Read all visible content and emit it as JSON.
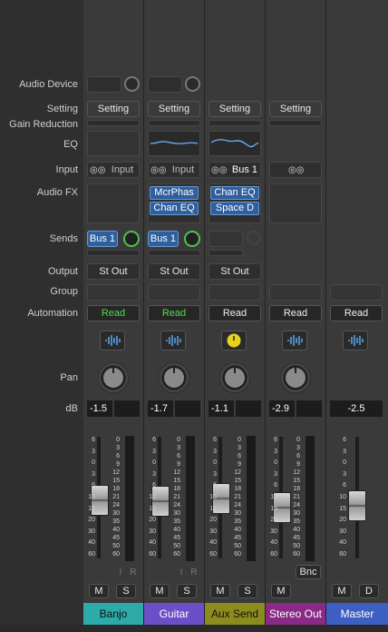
{
  "row_labels": {
    "audio_device": "Audio Device",
    "setting": "Setting",
    "gain_reduction": "Gain Reduction",
    "eq": "EQ",
    "input": "Input",
    "audio_fx": "Audio FX",
    "sends": "Sends",
    "output": "Output",
    "group": "Group",
    "automation": "Automation",
    "pan": "Pan",
    "db": "dB"
  },
  "fader_scale": [
    "6",
    "3",
    "0",
    "3",
    "6",
    "10",
    "15",
    "20",
    "30",
    "40",
    "60"
  ],
  "meter_scale": [
    "0",
    "3",
    "6",
    "9",
    "12",
    "15",
    "18",
    "21",
    "24",
    "30",
    "35",
    "40",
    "45",
    "50",
    "60"
  ],
  "channels": [
    {
      "name": "Banjo",
      "color": "#2eaaa8",
      "setting": "Setting",
      "input": "Input",
      "fx": [],
      "send": "Bus 1",
      "output": "St Out",
      "automation": "Read",
      "automation_green": true,
      "db": "-1.5",
      "fader_level": 0.63,
      "mute": "M",
      "solo": "S",
      "i": "I",
      "r": "R"
    },
    {
      "name": "Guitar",
      "color": "#6b4fc8",
      "setting": "Setting",
      "input": "Input",
      "fx": [
        "McrPhas",
        "Chan EQ"
      ],
      "send": "Bus 1",
      "output": "St Out",
      "automation": "Read",
      "automation_green": true,
      "db": "-1.7",
      "fader_level": 0.62,
      "mute": "M",
      "solo": "S",
      "i": "I",
      "r": "R"
    },
    {
      "name": "Aux Send",
      "color": "#8c8c1e",
      "setting": "Setting",
      "input": "Bus 1",
      "fx": [
        "Chan EQ",
        "Space D"
      ],
      "send": "",
      "output": "St Out",
      "automation": "Read",
      "automation_green": false,
      "db": "-1.1",
      "fader_level": 0.64,
      "mute": "M",
      "solo": "S"
    },
    {
      "name": "Stereo Out",
      "color": "#8a2a86",
      "setting": "Setting",
      "input": "",
      "fx": [],
      "send": "",
      "output": "",
      "automation": "Read",
      "automation_green": false,
      "db": "-2.9",
      "fader_level": 0.57,
      "mute": "M",
      "bnc": "Bnc"
    },
    {
      "name": "Master",
      "color": "#3d5fc4",
      "setting": "",
      "input": "",
      "fx": [],
      "send": "",
      "output": "",
      "automation": "Read",
      "automation_green": false,
      "db": "-2.5",
      "fader_level": 0.58,
      "mute": "M",
      "dim": "D"
    }
  ]
}
